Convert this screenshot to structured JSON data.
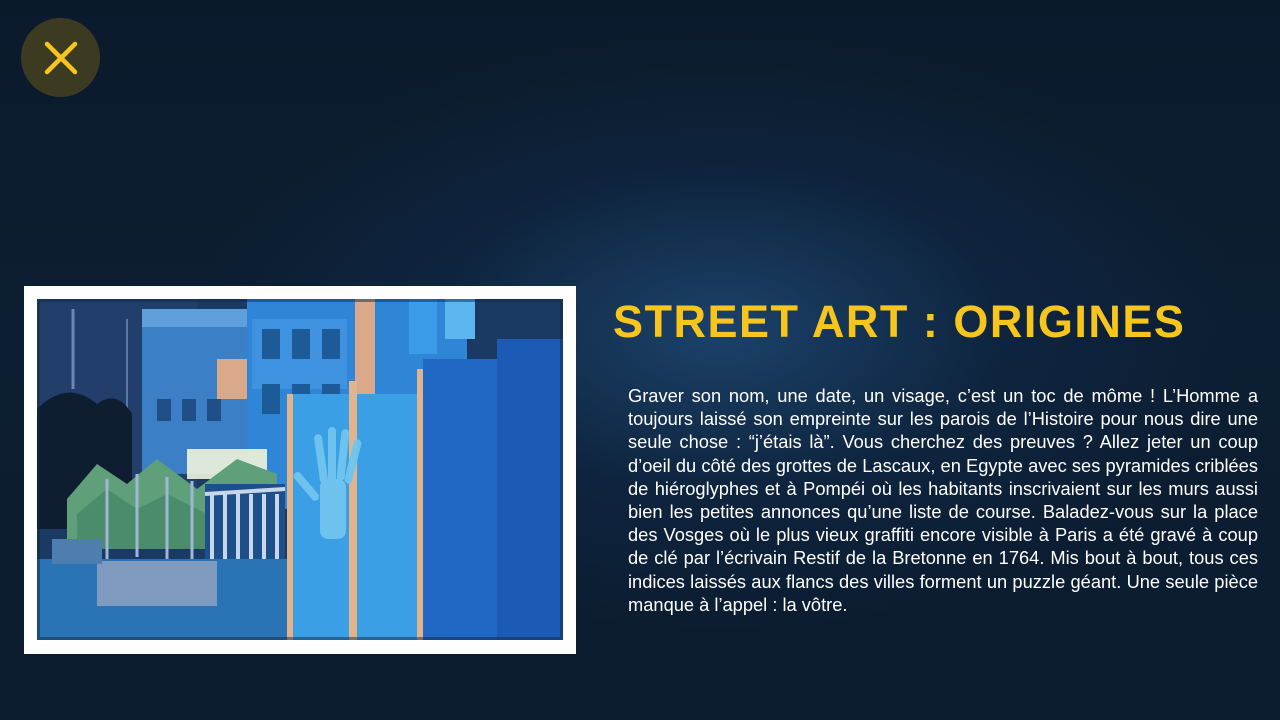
{
  "close_button": {
    "icon": "close-icon",
    "color": "#f7c51c"
  },
  "article": {
    "title": "STREET ART : ORIGINES",
    "body": "Graver son nom, une date, un visage, c’est un toc de môme ! L’Homme a toujours laissé son empreinte sur les parois de l’Histoire pour nous dire une seule chose : “j’étais là”. Vous cherchez des preuves ? Allez jeter un coup d’oeil du côté des grottes de Lascaux, en Egypte avec ses pyramides criblées de hiéroglyphes et à Pompéi où les habitants inscrivaient sur les murs aussi bien les petites annonces qu’une liste de course. Baladez-vous sur la place des Vosges où le plus vieux graffiti encore visible à Paris a été gravé à coup de clé par l’écrivain Restif de la Bretonne en 1764. Mis bout à bout, tous ces indices laissés aux flancs des villes forment un puzzle géant. Une seule pièce manque à l’appel : la vôtre."
  },
  "colors": {
    "accent": "#f7c51c",
    "background": "#0c1e33",
    "text": "#ffffff"
  }
}
